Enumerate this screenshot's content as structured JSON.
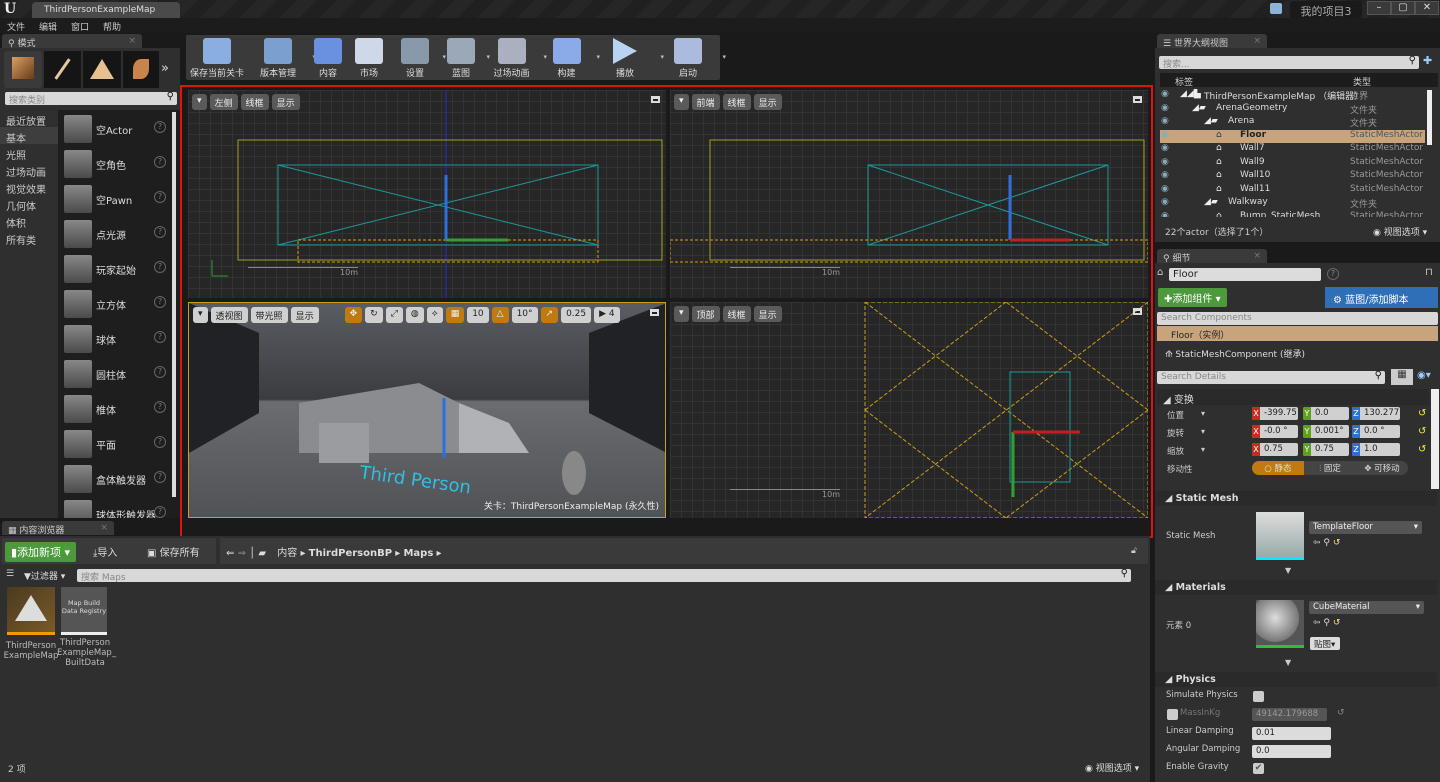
{
  "titlebar": {
    "doc_tab": "ThirdPersonExampleMap",
    "project": "我的项目3",
    "logo": "U"
  },
  "menu": [
    "文件",
    "编辑",
    "窗口",
    "帮助"
  ],
  "modes": {
    "tab": "模式",
    "search_placeholder": "搜索类别",
    "categories": [
      "最近放置",
      "基本",
      "光照",
      "过场动画",
      "视觉效果",
      "几何体",
      "体积",
      "所有类"
    ],
    "selected_category": "基本",
    "items": [
      "空Actor",
      "空角色",
      "空Pawn",
      "点光源",
      "玩家起始",
      "立方体",
      "球体",
      "圆柱体",
      "椎体",
      "平面",
      "盒体触发器",
      "球体形触发器"
    ]
  },
  "toolbar": [
    {
      "label": "保存当前关卡",
      "icon": "save-icon",
      "dd": false
    },
    {
      "label": "版本管理",
      "icon": "source-control-icon",
      "dd": true
    },
    {
      "label": "内容",
      "icon": "content-icon",
      "dd": false
    },
    {
      "label": "市场",
      "icon": "marketplace-icon",
      "dd": false
    },
    {
      "label": "设置",
      "icon": "settings-icon",
      "dd": true
    },
    {
      "label": "蓝图",
      "icon": "blueprint-icon",
      "dd": true
    },
    {
      "label": "过场动画",
      "icon": "cinematics-icon",
      "dd": true
    },
    {
      "label": "构建",
      "icon": "build-icon",
      "dd": true
    },
    {
      "label": "播放",
      "icon": "play-icon",
      "dd": true
    },
    {
      "label": "启动",
      "icon": "launch-icon",
      "dd": true
    }
  ],
  "viewports": {
    "left": {
      "view": "左侧",
      "mode": "线框",
      "show": "显示",
      "scale": "10m"
    },
    "front": {
      "view": "前端",
      "mode": "线框",
      "show": "显示",
      "scale": "10m"
    },
    "perspective": {
      "view": "透视图",
      "mode": "带光照",
      "show": "显示",
      "grid_snap": "10",
      "rot_snap": "10°",
      "scale_snap": "0.25",
      "cam_speed": "4",
      "level_label": "关卡：ThirdPersonExampleMap (永久性)",
      "floor_text": "Third Person"
    },
    "top": {
      "view": "顶部",
      "mode": "线框",
      "show": "显示",
      "scale": "10m"
    }
  },
  "content_browser": {
    "tab": "内容浏览器",
    "add_new": "添加新项",
    "import": "导入",
    "save_all": "保存所有",
    "path": [
      "内容",
      "ThirdPersonBP",
      "Maps"
    ],
    "filters": "过滤器",
    "search_placeholder": "搜索 Maps",
    "assets": [
      {
        "name": "ThirdPerson ExampleMap",
        "thumb_text": ""
      },
      {
        "name": "ThirdPerson ExampleMap_ BuiltData",
        "thumb_text": "Map Build Data Registry"
      }
    ],
    "count": "2 项",
    "view_options": "视图选项"
  },
  "outliner": {
    "tab": "世界大纲视图",
    "search_placeholder": "搜索...",
    "col_label": "标签",
    "col_type": "类型",
    "rows": [
      {
        "name": "ThirdPersonExampleMap （编辑器）",
        "type": "世界",
        "depth": 0,
        "kind": "world"
      },
      {
        "name": "ArenaGeometry",
        "type": "文件夹",
        "depth": 1,
        "kind": "folder"
      },
      {
        "name": "Arena",
        "type": "文件夹",
        "depth": 2,
        "kind": "folder"
      },
      {
        "name": "Floor",
        "type": "StaticMeshActor",
        "depth": 3,
        "kind": "actor",
        "selected": true
      },
      {
        "name": "Wall7",
        "type": "StaticMeshActor",
        "depth": 3,
        "kind": "actor"
      },
      {
        "name": "Wall9",
        "type": "StaticMeshActor",
        "depth": 3,
        "kind": "actor"
      },
      {
        "name": "Wall10",
        "type": "StaticMeshActor",
        "depth": 3,
        "kind": "actor"
      },
      {
        "name": "Wall11",
        "type": "StaticMeshActor",
        "depth": 3,
        "kind": "actor"
      },
      {
        "name": "Walkway",
        "type": "文件夹",
        "depth": 2,
        "kind": "folder"
      },
      {
        "name": "Bump_StaticMesh",
        "type": "StaticMeshActor",
        "depth": 3,
        "kind": "actor"
      }
    ],
    "status": "22个actor（选择了1个）",
    "view_options": "视图选项"
  },
  "details": {
    "tab": "细节",
    "actor_name": "Floor",
    "add_component": "添加组件",
    "blueprint": "蓝图/添加脚本",
    "search_components": "Search Components",
    "root": "Floor（实例）",
    "component": "StaticMeshComponent (继承)",
    "search_details": "Search Details",
    "transform": {
      "title": "变换",
      "location": {
        "label": "位置",
        "x": "-399.75",
        "y": "0.0",
        "z": "130.277"
      },
      "rotation": {
        "label": "旋转",
        "x": "-0.0 °",
        "y": "0.001°",
        "z": "0.0 °"
      },
      "scale": {
        "label": "缩放",
        "x": "0.75",
        "y": "0.75",
        "z": "1.0"
      },
      "mobility": {
        "label": "移动性",
        "options": [
          "静态",
          "固定",
          "可移动"
        ],
        "selected": "静态"
      }
    },
    "static_mesh": {
      "title": "Static Mesh",
      "label": "Static Mesh",
      "value": "TemplateFloor"
    },
    "materials": {
      "title": "Materials",
      "label": "元素 0",
      "value": "CubeMaterial",
      "texture_btn": "贴图"
    },
    "physics": {
      "title": "Physics",
      "simulate": {
        "label": "Simulate Physics",
        "checked": false
      },
      "mass": {
        "label": "MassInKg",
        "value": "49142.179688"
      },
      "linear": {
        "label": "Linear Damping",
        "value": "0.01"
      },
      "angular": {
        "label": "Angular Damping",
        "value": "0.0"
      },
      "gravity": {
        "label": "Enable Gravity",
        "checked": true
      }
    }
  },
  "colors": {
    "accent_orange": "#c07a10",
    "selection": "#c7a47c",
    "green": "#4c9a3c",
    "blue": "#2f6fb8",
    "highlight_red": "#e3120b"
  }
}
